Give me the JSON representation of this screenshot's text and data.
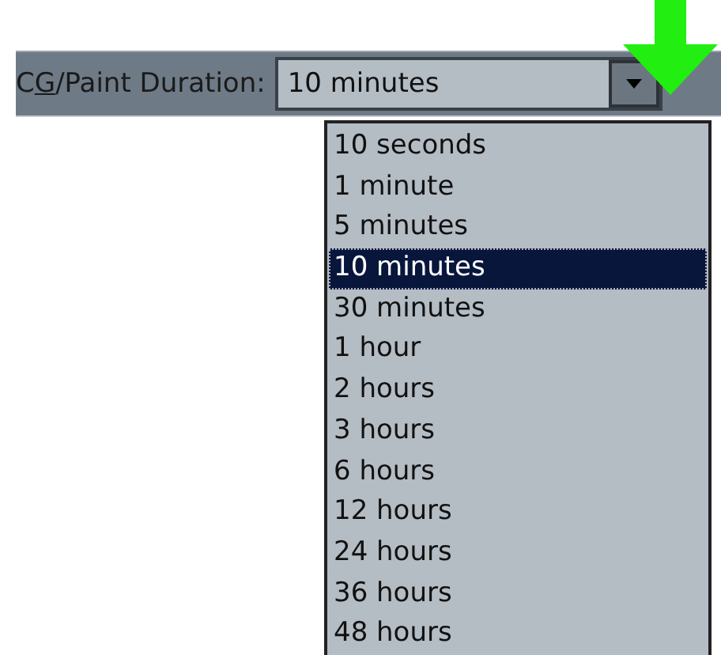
{
  "field": {
    "label_before": "C",
    "access_key": "G",
    "label_after": "/Paint Duration:",
    "value": "10 minutes",
    "expanded": true
  },
  "options": [
    {
      "label": "10 seconds",
      "selected": false
    },
    {
      "label": "1 minute",
      "selected": false
    },
    {
      "label": "5 minutes",
      "selected": false
    },
    {
      "label": "10 minutes",
      "selected": true
    },
    {
      "label": "30 minutes",
      "selected": false
    },
    {
      "label": "1 hour",
      "selected": false
    },
    {
      "label": "2 hours",
      "selected": false
    },
    {
      "label": "3 hours",
      "selected": false
    },
    {
      "label": "6 hours",
      "selected": false
    },
    {
      "label": "12 hours",
      "selected": false
    },
    {
      "label": "24 hours",
      "selected": false
    },
    {
      "label": "36 hours",
      "selected": false
    },
    {
      "label": "48 hours",
      "selected": false
    }
  ]
}
